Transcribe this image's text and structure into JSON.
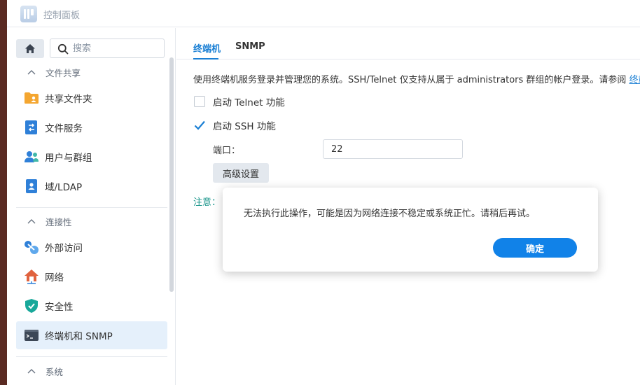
{
  "window": {
    "title": "控制面板"
  },
  "sidebar": {
    "search_placeholder": "搜索",
    "groups": [
      {
        "label": "文件共享"
      },
      {
        "label": "连接性"
      },
      {
        "label": "系统"
      }
    ],
    "items": [
      {
        "label": "共享文件夹"
      },
      {
        "label": "文件服务"
      },
      {
        "label": "用户与群组"
      },
      {
        "label": "域/LDAP"
      },
      {
        "label": "外部访问"
      },
      {
        "label": "网络"
      },
      {
        "label": "安全性"
      },
      {
        "label": "终端机和 SNMP"
      }
    ]
  },
  "main": {
    "tabs": [
      {
        "label": "终端机"
      },
      {
        "label": "SNMP"
      }
    ],
    "description": "使用终端机服务登录并管理您的系统。SSH/Telnet 仅支持从属于 administrators 群组的帐户登录。请参阅",
    "description_link": "终端",
    "telnet_label": "启动 Telnet 功能",
    "telnet_enabled": false,
    "ssh_label": "启动 SSH 功能",
    "ssh_enabled": true,
    "port_label": "端口：",
    "port_value": "22",
    "advanced_button": "高级设置",
    "note_label": "注意："
  },
  "dialog": {
    "message": "无法执行此操作，可能是因为网络连接不稳定或系统正忙。请稍后再试。",
    "ok_button": "确定"
  },
  "colors": {
    "accent": "#1a7fd4",
    "note": "#18948a",
    "active_item_bg": "#e5f0fb"
  }
}
